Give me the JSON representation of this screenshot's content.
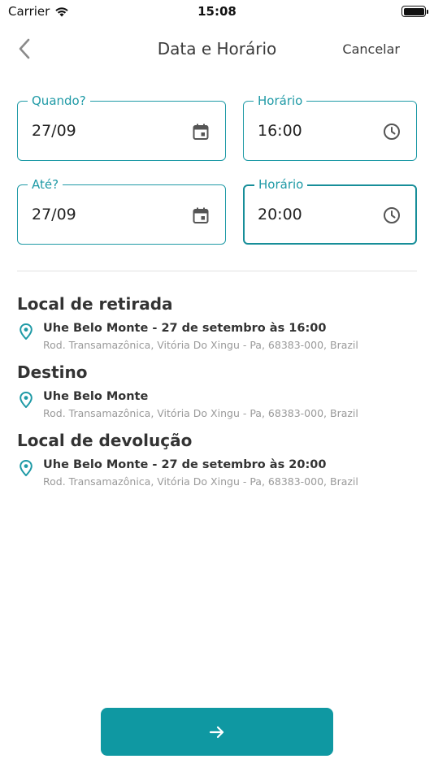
{
  "status_bar": {
    "carrier": "Carrier",
    "time": "15:08"
  },
  "nav": {
    "title": "Data e Horário",
    "cancel_label": "Cancelar"
  },
  "form": {
    "start_date": {
      "label": "Quando?",
      "value": "27/09",
      "icon": "calendar-icon"
    },
    "start_time": {
      "label": "Horário",
      "value": "16:00",
      "icon": "clock-icon"
    },
    "end_date": {
      "label": "Até?",
      "value": "27/09",
      "icon": "calendar-icon"
    },
    "end_time": {
      "label": "Horário",
      "value": "20:00",
      "icon": "clock-icon"
    }
  },
  "sections": {
    "pickup": {
      "title": "Local de retirada",
      "name": "Uhe Belo Monte - 27 de setembro às 16:00",
      "address": "Rod. Transamazônica, Vitória Do Xingu - Pa, 68383-000, Brazil"
    },
    "destination": {
      "title": "Destino",
      "name": "Uhe Belo Monte",
      "address": "Rod. Transamazônica, Vitória Do Xingu - Pa, 68383-000, Brazil"
    },
    "return": {
      "title": "Local de devolução",
      "name": "Uhe Belo Monte - 27 de setembro às 20:00",
      "address": "Rod. Transamazônica, Vitória Do Xingu - Pa, 68383-000, Brazil"
    }
  },
  "colors": {
    "accent": "#1f9aa6",
    "button": "#0f98a2",
    "pin": "#1f9aa6"
  },
  "next_button": {
    "icon": "arrow-right-icon"
  }
}
